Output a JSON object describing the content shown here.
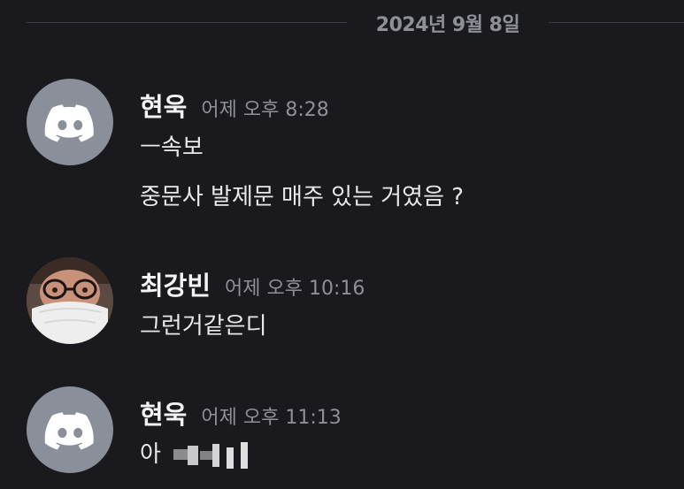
{
  "date_divider": "2024년 9월 8일",
  "messages": [
    {
      "author": "현욱",
      "timestamp": "어제 오후 8:28",
      "avatar": "discord-default-avatar-icon",
      "lines": [
        "ㅡ속보",
        "중문사 발제문 매주 있는 거였음 ?"
      ]
    },
    {
      "author": "최강빈",
      "timestamp": "어제 오후 10:16",
      "avatar": "profile-photo",
      "lines": [
        "그런거같은디"
      ]
    },
    {
      "author": "현욱",
      "timestamp": "어제 오후 11:13",
      "avatar": "discord-default-avatar-icon",
      "lines": [
        "아"
      ]
    }
  ],
  "colors": {
    "background": "#1a1a1e",
    "author": "#f2f3f5",
    "timestamp": "#8e9098",
    "text": "#e7e8ea",
    "discord_avatar_bg": "#8b8f9a"
  }
}
